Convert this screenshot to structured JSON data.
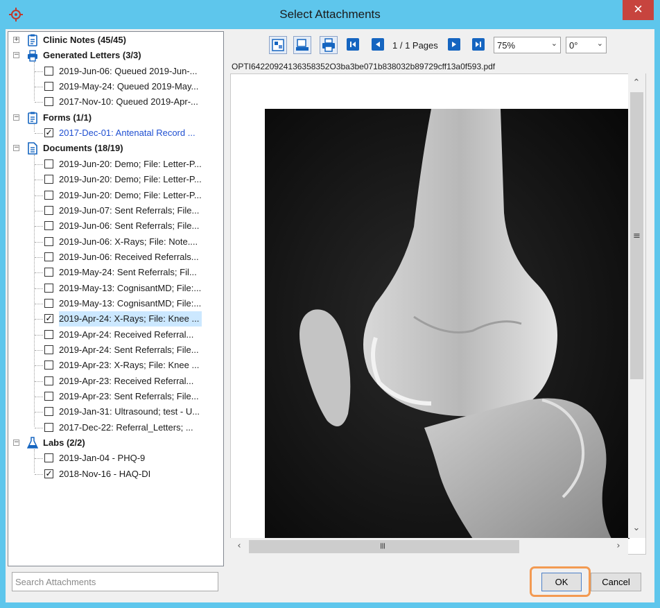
{
  "window": {
    "title": "Select Attachments",
    "close_glyph": "✕"
  },
  "tree": {
    "groups": [
      {
        "label": "Clinic Notes (45/45)",
        "icon": "clipboard-icon",
        "expanded": false,
        "items": []
      },
      {
        "label": "Generated Letters (3/3)",
        "icon": "printer-icon",
        "expanded": true,
        "items": [
          {
            "label": "2019-Jun-06: Queued 2019-Jun-...",
            "checked": false
          },
          {
            "label": "2019-May-24: Queued 2019-May...",
            "checked": false
          },
          {
            "label": "2017-Nov-10: Queued 2019-Apr-...",
            "checked": false
          }
        ]
      },
      {
        "label": "Forms (1/1)",
        "icon": "clipboard-icon",
        "expanded": true,
        "items": [
          {
            "label": "2017-Dec-01: Antenatal Record ...",
            "checked": true
          }
        ]
      },
      {
        "label": "Documents (18/19)",
        "icon": "document-icon",
        "expanded": true,
        "items": [
          {
            "label": "2019-Jun-20: Demo; File: Letter-P...",
            "checked": false
          },
          {
            "label": "2019-Jun-20: Demo; File: Letter-P...",
            "checked": false
          },
          {
            "label": "2019-Jun-20: Demo; File: Letter-P...",
            "checked": false
          },
          {
            "label": "2019-Jun-07: Sent Referrals; File...",
            "checked": false
          },
          {
            "label": "2019-Jun-06: Sent Referrals; File...",
            "checked": false
          },
          {
            "label": "2019-Jun-06: X-Rays; File: Note....",
            "checked": false
          },
          {
            "label": "2019-Jun-06: Received Referrals...",
            "checked": false
          },
          {
            "label": "2019-May-24: Sent Referrals; Fil...",
            "checked": false
          },
          {
            "label": "2019-May-13: CognisantMD; File:...",
            "checked": false
          },
          {
            "label": "2019-May-13: CognisantMD; File:...",
            "checked": false
          },
          {
            "label": "2019-Apr-24: X-Rays; File: Knee ...",
            "checked": true
          },
          {
            "label": "2019-Apr-24: Received Referral...",
            "checked": false
          },
          {
            "label": "2019-Apr-24: Sent Referrals; File...",
            "checked": false
          },
          {
            "label": "2019-Apr-23: X-Rays; File: Knee ...",
            "checked": false
          },
          {
            "label": "2019-Apr-23: Received Referral...",
            "checked": false
          },
          {
            "label": "2019-Apr-23: Sent Referrals; File...",
            "checked": false
          },
          {
            "label": "2019-Jan-31: Ultrasound; test - U...",
            "checked": false
          },
          {
            "label": "2017-Dec-22: Referral_Letters; ...",
            "checked": false
          }
        ]
      },
      {
        "label": "Labs (2/2)",
        "icon": "flask-icon",
        "expanded": true,
        "items": [
          {
            "label": "2019-Jan-04 - PHQ-9",
            "checked": false
          },
          {
            "label": "2018-Nov-16 - HAQ-DI",
            "checked": true
          }
        ]
      }
    ]
  },
  "search": {
    "placeholder": "Search Attachments"
  },
  "viewer": {
    "page_info": "1 / 1 Pages",
    "zoom": "75%",
    "rotation": "0°",
    "filename": "OPTI64220924136358352O3ba3be071b838032b89729cff13a0f593.pdf"
  },
  "buttons": {
    "ok": "OK",
    "cancel": "Cancel"
  },
  "colors": {
    "titlebar": "#5ec6ec",
    "accent": "#1565c0",
    "highlight": "#f39a52",
    "close": "#c7443e"
  }
}
